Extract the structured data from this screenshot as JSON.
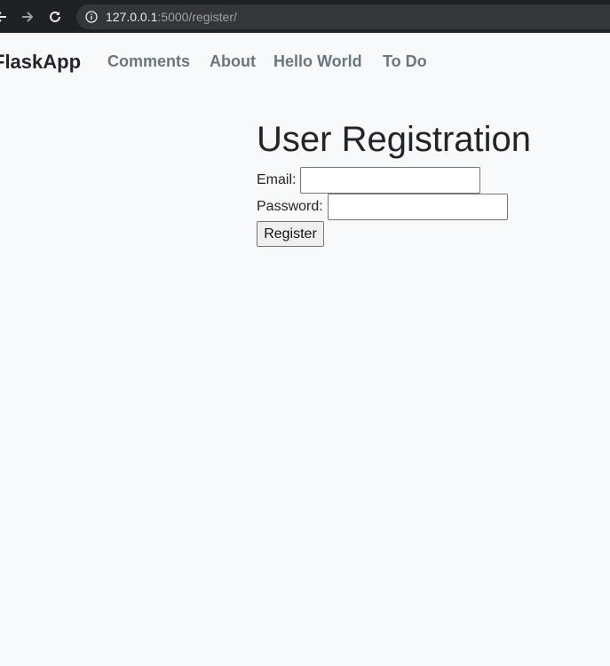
{
  "browser": {
    "url_host": "127.0.0.1",
    "url_rest": ":5000/register/"
  },
  "navbar": {
    "brand": "FlaskApp",
    "links": [
      "Comments",
      "About",
      "Hello World",
      "To Do"
    ]
  },
  "form": {
    "title": "User Registration",
    "email_label": "Email:",
    "email_value": "",
    "password_label": "Password:",
    "password_value": "",
    "submit_label": "Register"
  },
  "colors": {
    "page_background": "#f8f9fa",
    "browser_chrome": "#202124",
    "nav_link": "#6c757d",
    "brand_text": "#212529"
  }
}
